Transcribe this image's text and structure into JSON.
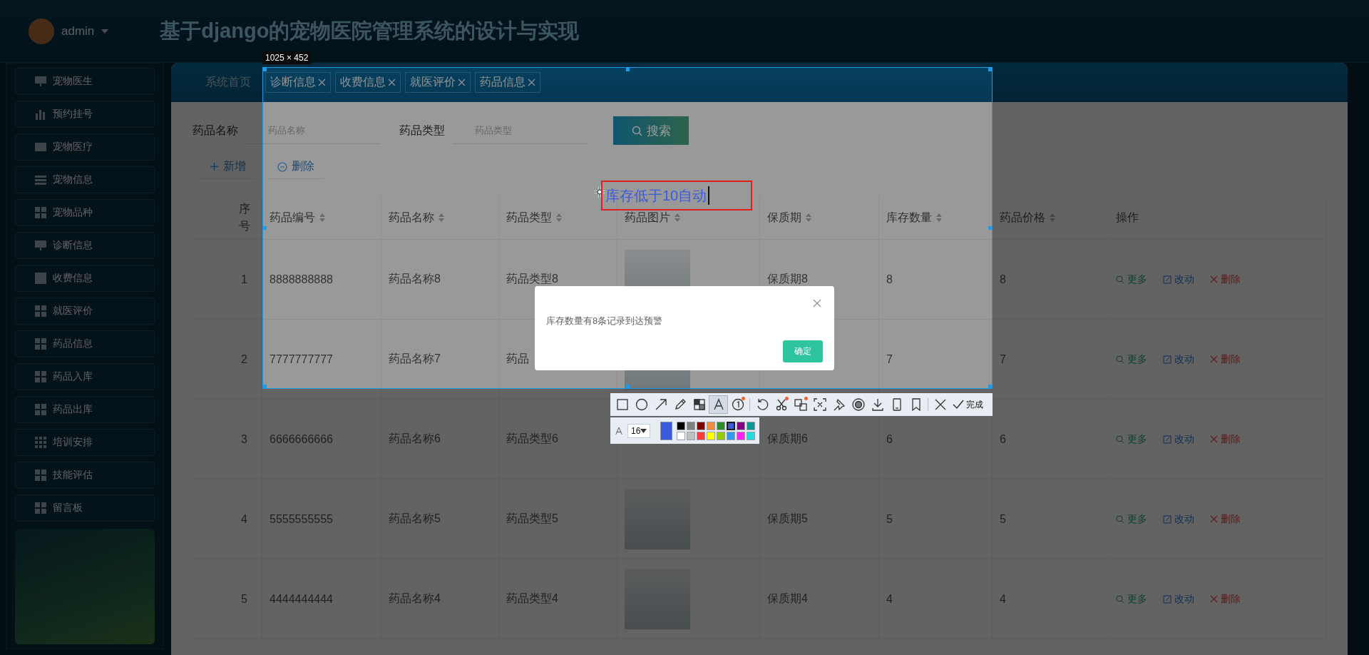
{
  "header": {
    "user": "admin",
    "title": "基于django的宠物医院管理系统的设计与实现"
  },
  "sidebar": {
    "items": [
      {
        "label": "宠物医生"
      },
      {
        "label": "预约挂号"
      },
      {
        "label": "宠物医疗"
      },
      {
        "label": "宠物信息"
      },
      {
        "label": "宠物品种"
      },
      {
        "label": "诊断信息"
      },
      {
        "label": "收费信息"
      },
      {
        "label": "就医评价"
      },
      {
        "label": "药品信息"
      },
      {
        "label": "药品入库"
      },
      {
        "label": "药品出库"
      },
      {
        "label": "培训安排"
      },
      {
        "label": "技能评估"
      },
      {
        "label": "留言板"
      }
    ]
  },
  "tabs": [
    {
      "label": "系统首页",
      "closable": false
    },
    {
      "label": "诊断信息",
      "closable": true
    },
    {
      "label": "收费信息",
      "closable": true
    },
    {
      "label": "就医评价",
      "closable": true
    },
    {
      "label": "药品信息",
      "closable": true
    }
  ],
  "search": {
    "fields": [
      {
        "label": "药品名称",
        "placeholder": "药品名称"
      },
      {
        "label": "药品类型",
        "placeholder": "药品类型"
      }
    ],
    "button": "搜索"
  },
  "actions": [
    {
      "kind": "add",
      "label": "新增"
    },
    {
      "kind": "delete",
      "label": "删除"
    }
  ],
  "table": {
    "columns": [
      {
        "label": "序号",
        "sortable": false
      },
      {
        "label": "药品编号",
        "sortable": true
      },
      {
        "label": "药品名称",
        "sortable": true
      },
      {
        "label": "药品类型",
        "sortable": true
      },
      {
        "label": "药品图片",
        "sortable": true
      },
      {
        "label": "保质期",
        "sortable": true
      },
      {
        "label": "库存数量",
        "sortable": true
      },
      {
        "label": "药品价格",
        "sortable": true
      },
      {
        "label": "操作",
        "sortable": false
      }
    ],
    "rows": [
      {
        "index": "1",
        "code": "8888888888",
        "name": "药品名称8",
        "type": "药品类型8",
        "photo": true,
        "shelf_life": "保质期8",
        "stock": "8",
        "price": "8",
        "actions": [
          "更多",
          "改动",
          "删除"
        ]
      },
      {
        "index": "2",
        "code": "7777777777",
        "name": "药品名称7",
        "type": "药品",
        "photo": true,
        "stock": "7",
        "price": "7",
        "actions": [
          "更多",
          "改动",
          "删除"
        ]
      },
      {
        "index": "3",
        "code": "6666666666",
        "name": "药品名称6",
        "type": "药品类型6",
        "photo": false,
        "shelf_life": "保质期6",
        "stock": "6",
        "price": "6",
        "actions": [
          "更多",
          "改动",
          "删除"
        ]
      },
      {
        "index": "4",
        "code": "5555555555",
        "name": "药品名称5",
        "type": "药品类型5",
        "photo": true,
        "shelf_life": "保质期5",
        "stock": "5",
        "price": "5",
        "actions": [
          "更多",
          "改动",
          "删除"
        ]
      },
      {
        "index": "5",
        "code": "4444444444",
        "name": "药品名称4",
        "type": "药品类型4",
        "photo": true,
        "shelf_life": "保质期4",
        "stock": "4",
        "price": "4",
        "actions": [
          "更多",
          "改动",
          "删除"
        ]
      }
    ]
  },
  "dialog": {
    "message": "库存数量有8条记录到达预警",
    "confirm": "确定"
  },
  "screenshot_tool": {
    "size_label": "1025 × 452",
    "annotation": "库存低于10自动",
    "font_size": "16",
    "done": "完成",
    "tools": [
      {
        "selected": false,
        "dot": false
      },
      {
        "selected": false,
        "dot": false
      },
      {
        "selected": false,
        "dot": false
      },
      {
        "selected": false,
        "dot": false
      },
      {
        "selected": false,
        "dot": false
      },
      {
        "selected": true,
        "dot": false
      },
      {
        "selected": false,
        "dot": true
      },
      {
        "selected": false,
        "dot": false
      },
      {
        "selected": false,
        "dot": true
      },
      {
        "selected": false,
        "dot": true
      },
      {
        "selected": false,
        "dot": false
      },
      {
        "selected": false,
        "dot": false
      },
      {
        "selected": false,
        "dot": false
      },
      {
        "selected": false,
        "dot": false
      },
      {
        "selected": false,
        "dot": false
      },
      {
        "selected": false,
        "dot": false
      },
      {
        "selected": false,
        "dot": false
      }
    ],
    "palette": [
      {
        "color": "#000000",
        "selected": false
      },
      {
        "color": "#808080",
        "selected": false
      },
      {
        "color": "#800000",
        "selected": false
      },
      {
        "color": "#f08c3c",
        "selected": false
      },
      {
        "color": "#2e8b2e",
        "selected": false
      },
      {
        "color": "#3b5bdb",
        "selected": true
      },
      {
        "color": "#800080",
        "selected": false
      },
      {
        "color": "#0f9595",
        "selected": false
      },
      {
        "color": "#ffffff",
        "selected": false
      },
      {
        "color": "#c0c0c0",
        "selected": false
      },
      {
        "color": "#ff3b3b",
        "selected": false
      },
      {
        "color": "#ffff00",
        "selected": false
      },
      {
        "color": "#99cc00",
        "selected": false
      },
      {
        "color": "#3399ee",
        "selected": false
      },
      {
        "color": "#ff22ee",
        "selected": false
      },
      {
        "color": "#22dddd",
        "selected": false
      }
    ]
  }
}
